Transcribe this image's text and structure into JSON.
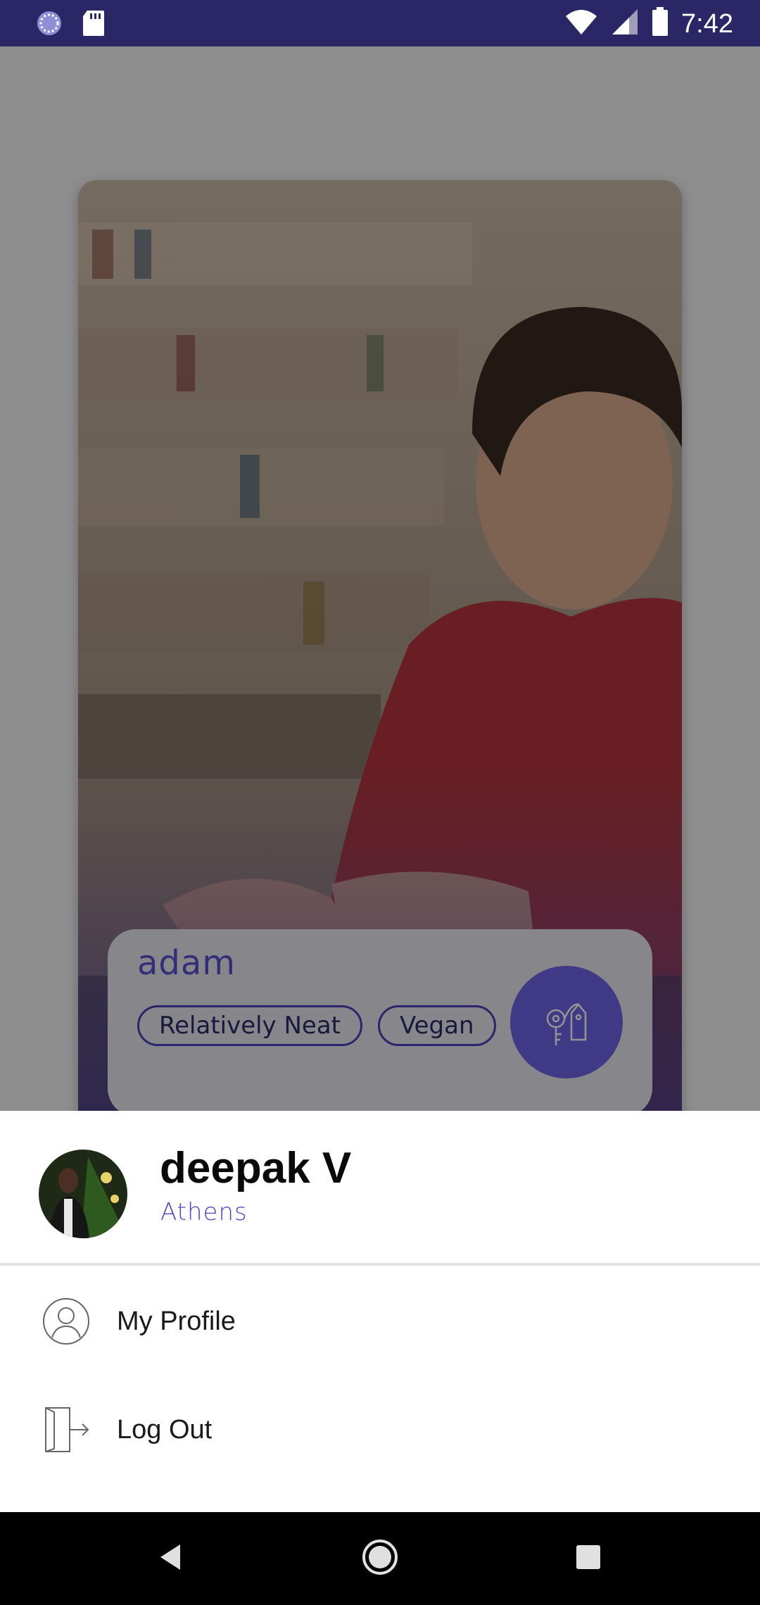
{
  "status_bar": {
    "time": "7:42",
    "left_icons": [
      "sync-icon",
      "sd-card-icon"
    ],
    "right_icons": [
      "wifi-icon",
      "cell-signal-icon",
      "battery-icon"
    ]
  },
  "card": {
    "name": "adam",
    "tags": [
      "Relatively Neat",
      "Vegan"
    ],
    "action_icon": "keys-icon"
  },
  "drawer": {
    "user": {
      "name": "deepak V",
      "city": "Athens"
    },
    "menu": [
      {
        "label": "My Profile",
        "icon": "profile-icon"
      },
      {
        "label": "Log Out",
        "icon": "logout-icon"
      }
    ]
  },
  "nav_bar": {
    "buttons": [
      "back-icon",
      "home-icon",
      "recents-icon"
    ]
  },
  "colors": {
    "status_bar": "#2b2766",
    "accent": "#5046c8",
    "chip_border": "#4a41b8",
    "match_button": "#6f62e6"
  }
}
